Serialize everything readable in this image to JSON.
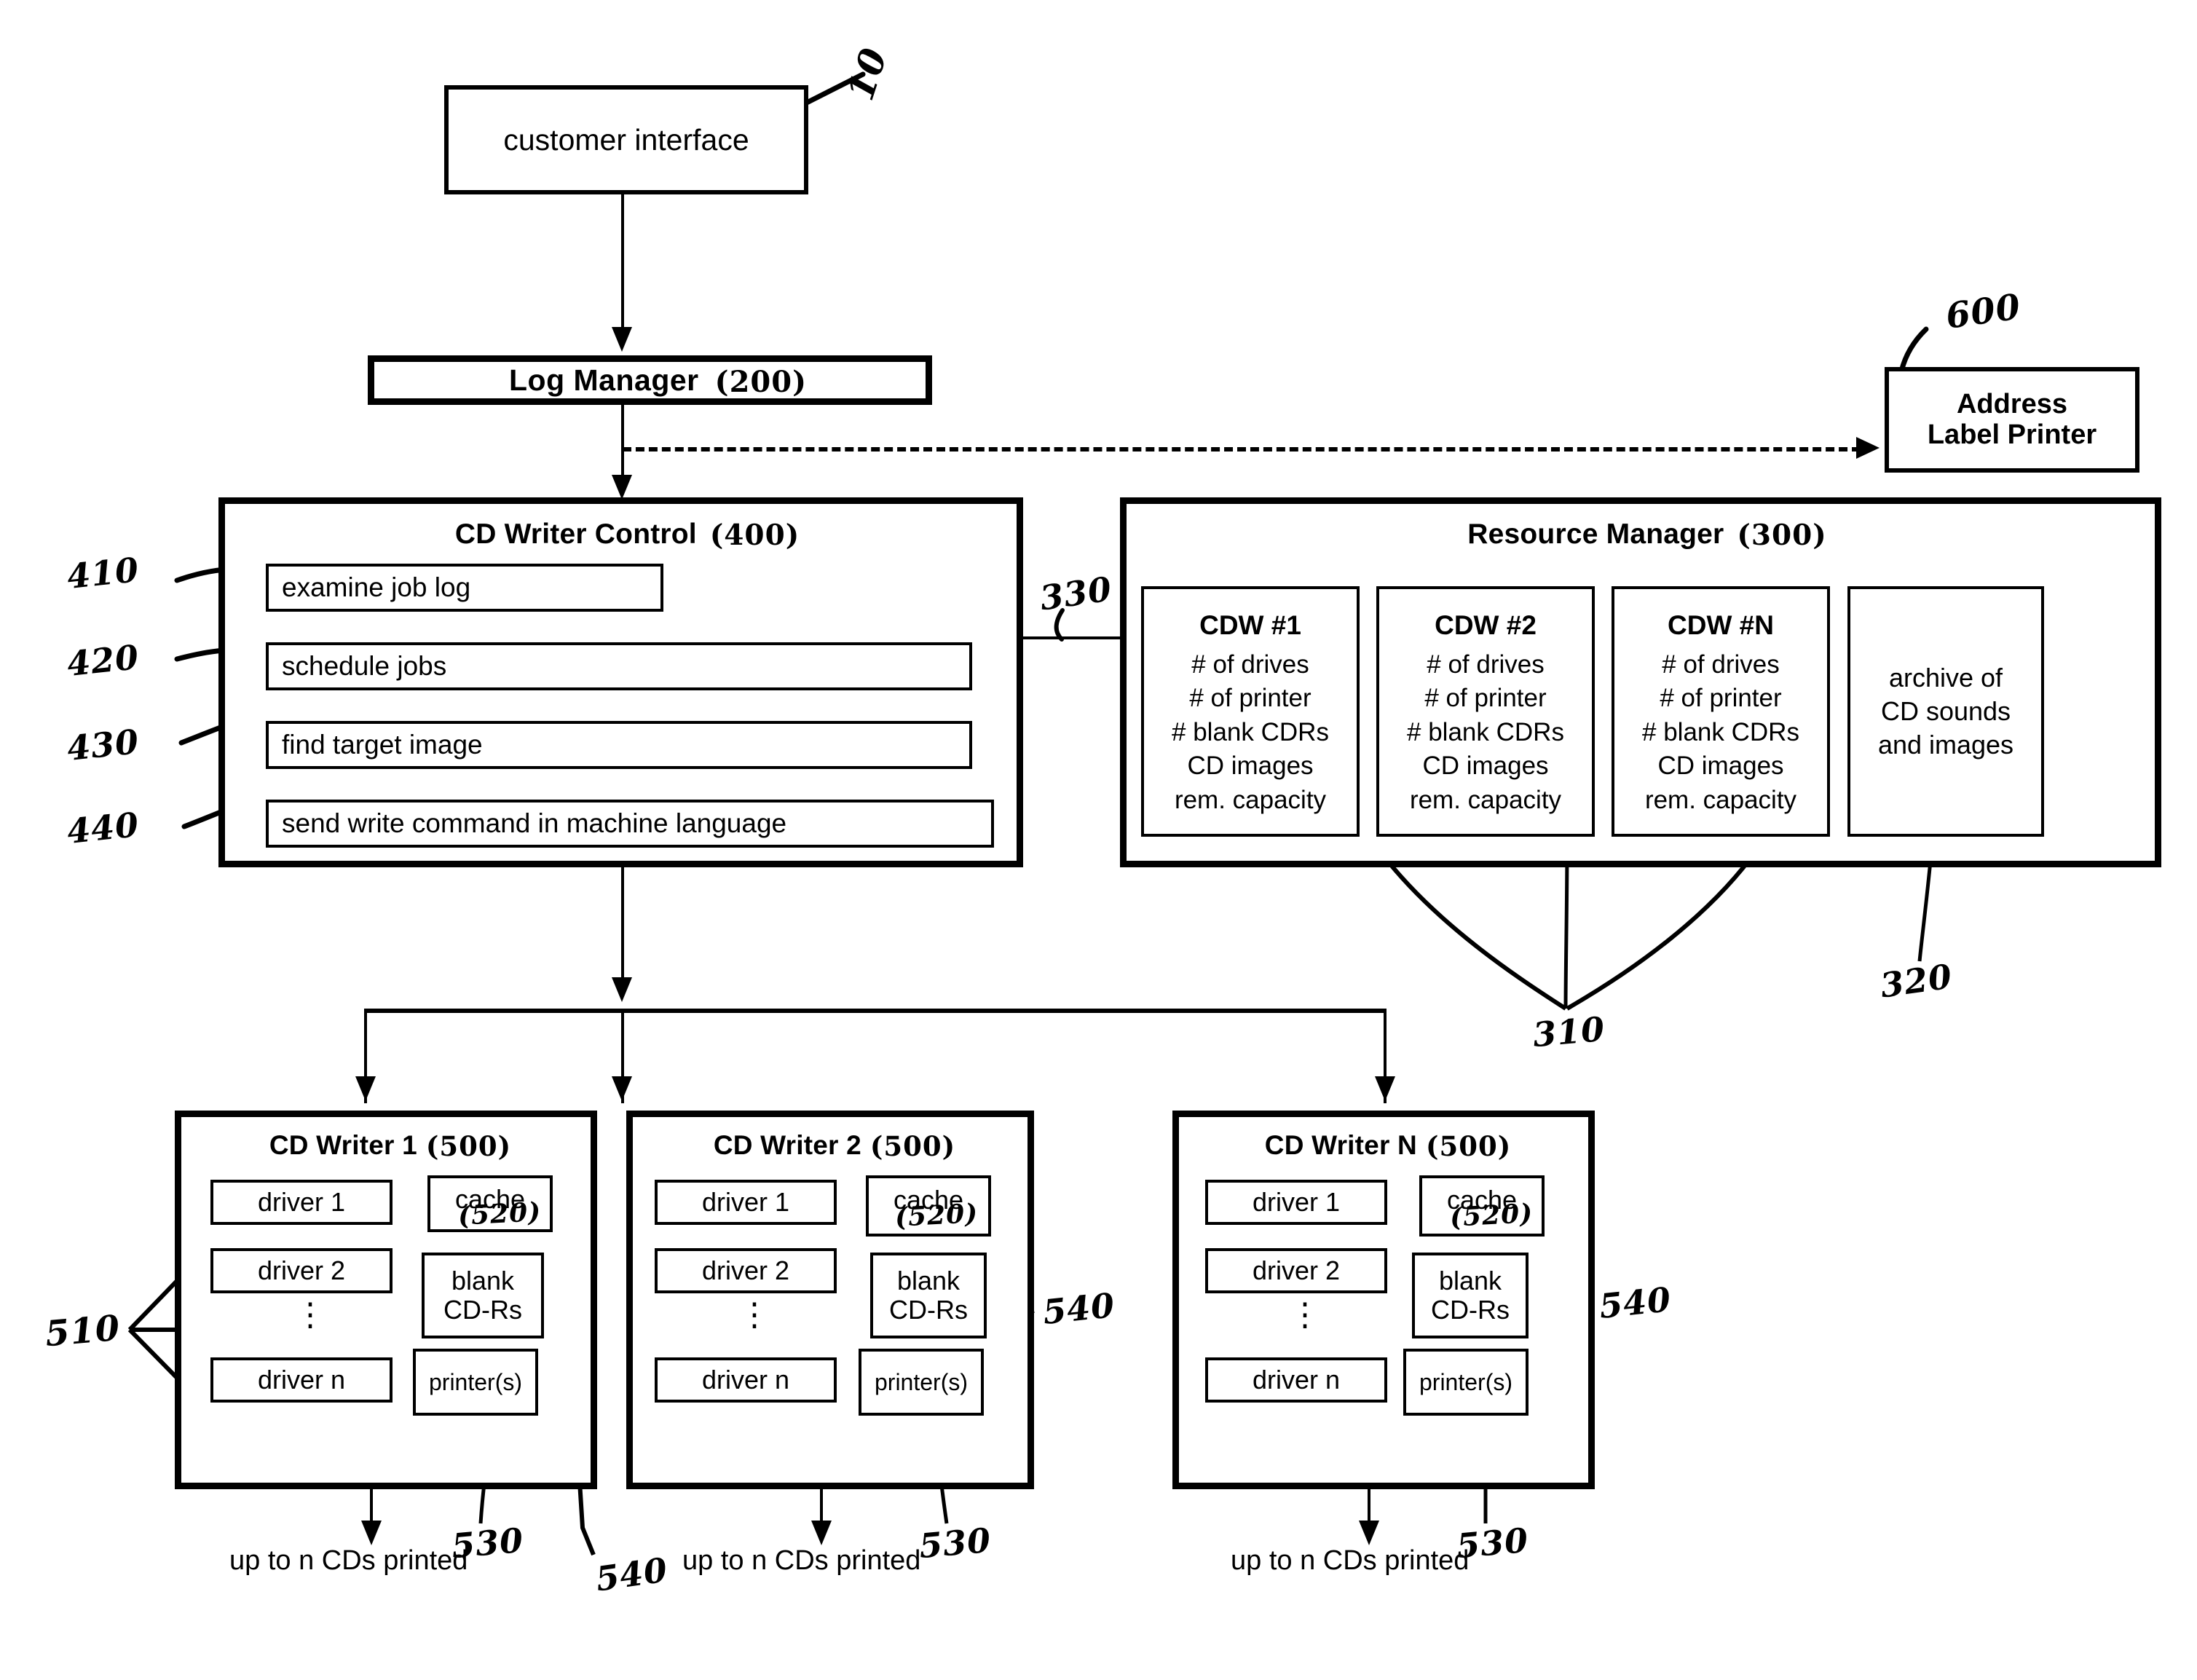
{
  "figure": {
    "customer_interface": {
      "label": "customer interface",
      "ref": "10"
    },
    "log_manager": {
      "label": "Log Manager",
      "ref": "(200)"
    },
    "address_label_printer": {
      "line1": "Address",
      "line2": "Label Printer",
      "ref": "600"
    },
    "cd_writer_control": {
      "title": "CD Writer Control",
      "ref": "(400)",
      "link_ref": "330",
      "steps": [
        {
          "label": "examine job log",
          "ref": "410"
        },
        {
          "label": "schedule jobs",
          "ref": "420"
        },
        {
          "label": "find target image",
          "ref": "430"
        },
        {
          "label": "send write command in machine language",
          "ref": "440"
        }
      ]
    },
    "resource_manager": {
      "title": "Resource Manager",
      "ref": "(300)",
      "cdw_ref": "310",
      "archive_ref": "320",
      "cdw_attributes": [
        "# of drives",
        "# of printer",
        "# blank CDRs",
        "CD images",
        "rem. capacity"
      ],
      "cdws": [
        {
          "name": "CDW #1"
        },
        {
          "name": "CDW #2"
        },
        {
          "name": "CDW #N"
        }
      ],
      "archive": {
        "line1": "archive of",
        "line2": "CD sounds",
        "line3": "and images"
      }
    },
    "cd_writers": [
      {
        "title": "CD Writer 1",
        "ref": "(500)",
        "drivers": [
          "driver 1",
          "driver 2",
          "driver n"
        ],
        "ellipsis": "⋮",
        "cache": "cache",
        "cache_ref": "(520)",
        "blank_line1": "blank",
        "blank_line2": "CD-Rs",
        "printer": "printer(s)",
        "driver_ref": "510",
        "printer_ref": "530",
        "blank_ref": "540",
        "output": "up to n CDs printed"
      },
      {
        "title": "CD Writer 2",
        "ref": "(500)",
        "drivers": [
          "driver 1",
          "driver 2",
          "driver n"
        ],
        "ellipsis": "⋮",
        "cache": "cache",
        "cache_ref": "(520)",
        "blank_line1": "blank",
        "blank_line2": "CD-Rs",
        "printer": "printer(s)",
        "printer_ref": "530",
        "blank_ref": "540",
        "output": "up to n CDs printed"
      },
      {
        "title": "CD Writer N",
        "ref": "(500)",
        "drivers": [
          "driver 1",
          "driver 2",
          "driver n"
        ],
        "ellipsis": "⋮",
        "cache": "cache",
        "cache_ref": "(520)",
        "blank_line1": "blank",
        "blank_line2": "CD-Rs",
        "printer": "printer(s)",
        "printer_ref": "530",
        "blank_ref": "540",
        "output": "up to n CDs printed"
      }
    ]
  },
  "colors": {
    "ink": "#000000",
    "paper": "#ffffff"
  }
}
